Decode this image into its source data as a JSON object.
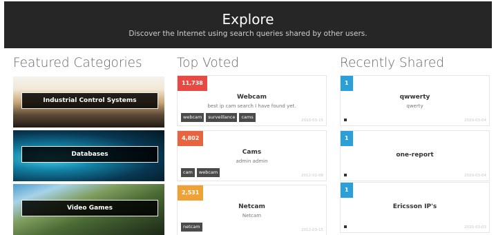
{
  "header": {
    "title": "Explore",
    "subtitle": "Discover the Internet using search queries shared by other users."
  },
  "featured": {
    "heading": "Featured Categories",
    "items": [
      {
        "label": "Industrial Control Systems"
      },
      {
        "label": "Databases"
      },
      {
        "label": "Video Games"
      }
    ]
  },
  "top_voted": {
    "heading": "Top Voted",
    "items": [
      {
        "votes": "11,738",
        "color": "#e84a43",
        "title": "Webcam",
        "desc": "best ip cam search I have found yet.",
        "tags": [
          "webcam",
          "surveillance",
          "cams"
        ],
        "date": "2010-03-15"
      },
      {
        "votes": "4,802",
        "color": "#e8633f",
        "title": "Cams",
        "desc": "admin admin",
        "tags": [
          "cam",
          "webcam"
        ],
        "date": "2012-02-06"
      },
      {
        "votes": "2,531",
        "color": "#eea235",
        "title": "Netcam",
        "desc": "Netcam",
        "tags": [
          "netcam"
        ],
        "date": "2012-03-15"
      }
    ]
  },
  "recently_shared": {
    "heading": "Recently Shared",
    "items": [
      {
        "votes": "1",
        "color": "#2a9fd8",
        "title": "qwwerty",
        "desc": "qwerty",
        "date": "2020-03-04"
      },
      {
        "votes": "1",
        "color": "#2a9fd8",
        "title": "one-report",
        "desc": "",
        "date": "2020-03-04"
      },
      {
        "votes": "1",
        "color": "#2a9fd8",
        "title": "Ericsson IP's",
        "desc": "",
        "date": "2020-03-03"
      }
    ]
  }
}
